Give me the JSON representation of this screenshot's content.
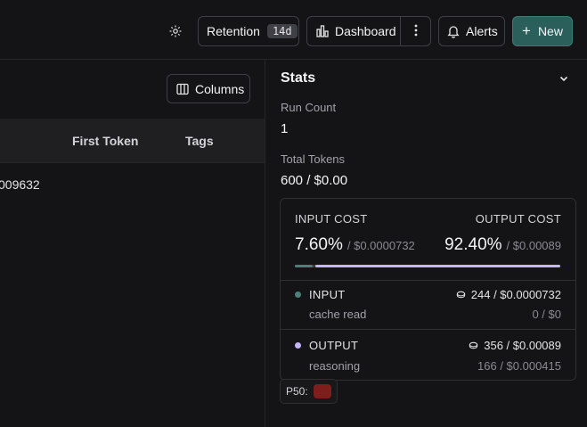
{
  "header": {
    "retention_label": "Retention",
    "retention_badge": "14d",
    "dashboard_label": "Dashboard",
    "alerts_label": "Alerts",
    "new_label": "New",
    "new_icon": "+"
  },
  "table": {
    "columns_button": "Columns",
    "headers": [
      "First Token",
      "Tags"
    ],
    "rows": [
      {
        "partial_value": "009632"
      }
    ]
  },
  "stats": {
    "title": "Stats",
    "run_count_label": "Run Count",
    "run_count_value": "1",
    "total_tokens_label": "Total Tokens",
    "total_tokens_value": "600 / $0.00",
    "cost": {
      "input_label": "INPUT COST",
      "output_label": "OUTPUT COST",
      "input_pct": "7.60%",
      "input_amount": "/ $0.0000732",
      "output_pct": "92.40%",
      "output_amount": "/ $0.00089",
      "input_fraction": 0.076,
      "output_fraction": 0.924
    },
    "breakdown": [
      {
        "name": "INPUT",
        "value": "244 / $0.0000732",
        "sub_label": "cache read",
        "sub_value": "0 / $0",
        "color": "#4f7f7a"
      },
      {
        "name": "OUTPUT",
        "value": "356 / $0.00089",
        "sub_label": "reasoning",
        "sub_value": "166 / $0.000415",
        "color": "#c4b5fd"
      }
    ],
    "p50_label": "P50:"
  },
  "colors": {
    "accent": "#2b5f5c",
    "input": "#4f7f7a",
    "output": "#c4b5fd"
  }
}
